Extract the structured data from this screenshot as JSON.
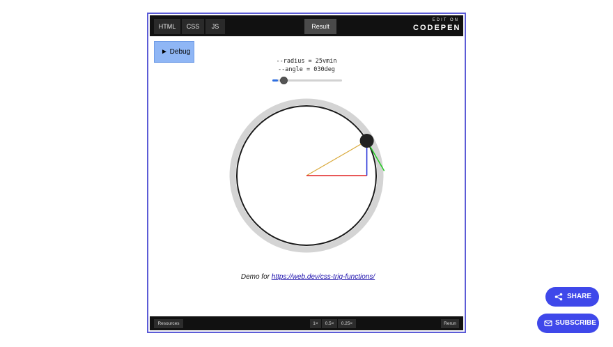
{
  "codepen": {
    "tabs": [
      "HTML",
      "CSS",
      "JS"
    ],
    "result_tab": "Result",
    "brand_top": "EDIT ON",
    "brand_main": "CODEPEN",
    "footer": {
      "resources": "Resources",
      "zoom_levels": [
        "1×",
        "0.5×",
        "0.25×"
      ],
      "rerun": "Rerun"
    }
  },
  "demo": {
    "debug_label": "► Debug",
    "radius_readout": "--radius = 25vmin",
    "angle_readout": "--angle = 030deg",
    "angle_deg": 30,
    "slider_fraction": 0.08,
    "caption_prefix": "Demo for",
    "caption_link": "https://web.dev/css-trig-functions/"
  },
  "fabs": {
    "share_label": "SHARE",
    "subscribe_label": "SUBSCRIBE"
  },
  "colors": {
    "frame_border": "#5b5bd6",
    "fab_blue": "#3f48ea",
    "debug_blue": "#8fb6f5",
    "cos_line": "#e02020",
    "sin_line": "#1f2bd6",
    "hypotenuse": "#d9a93a",
    "tangent": "#22cc22"
  }
}
